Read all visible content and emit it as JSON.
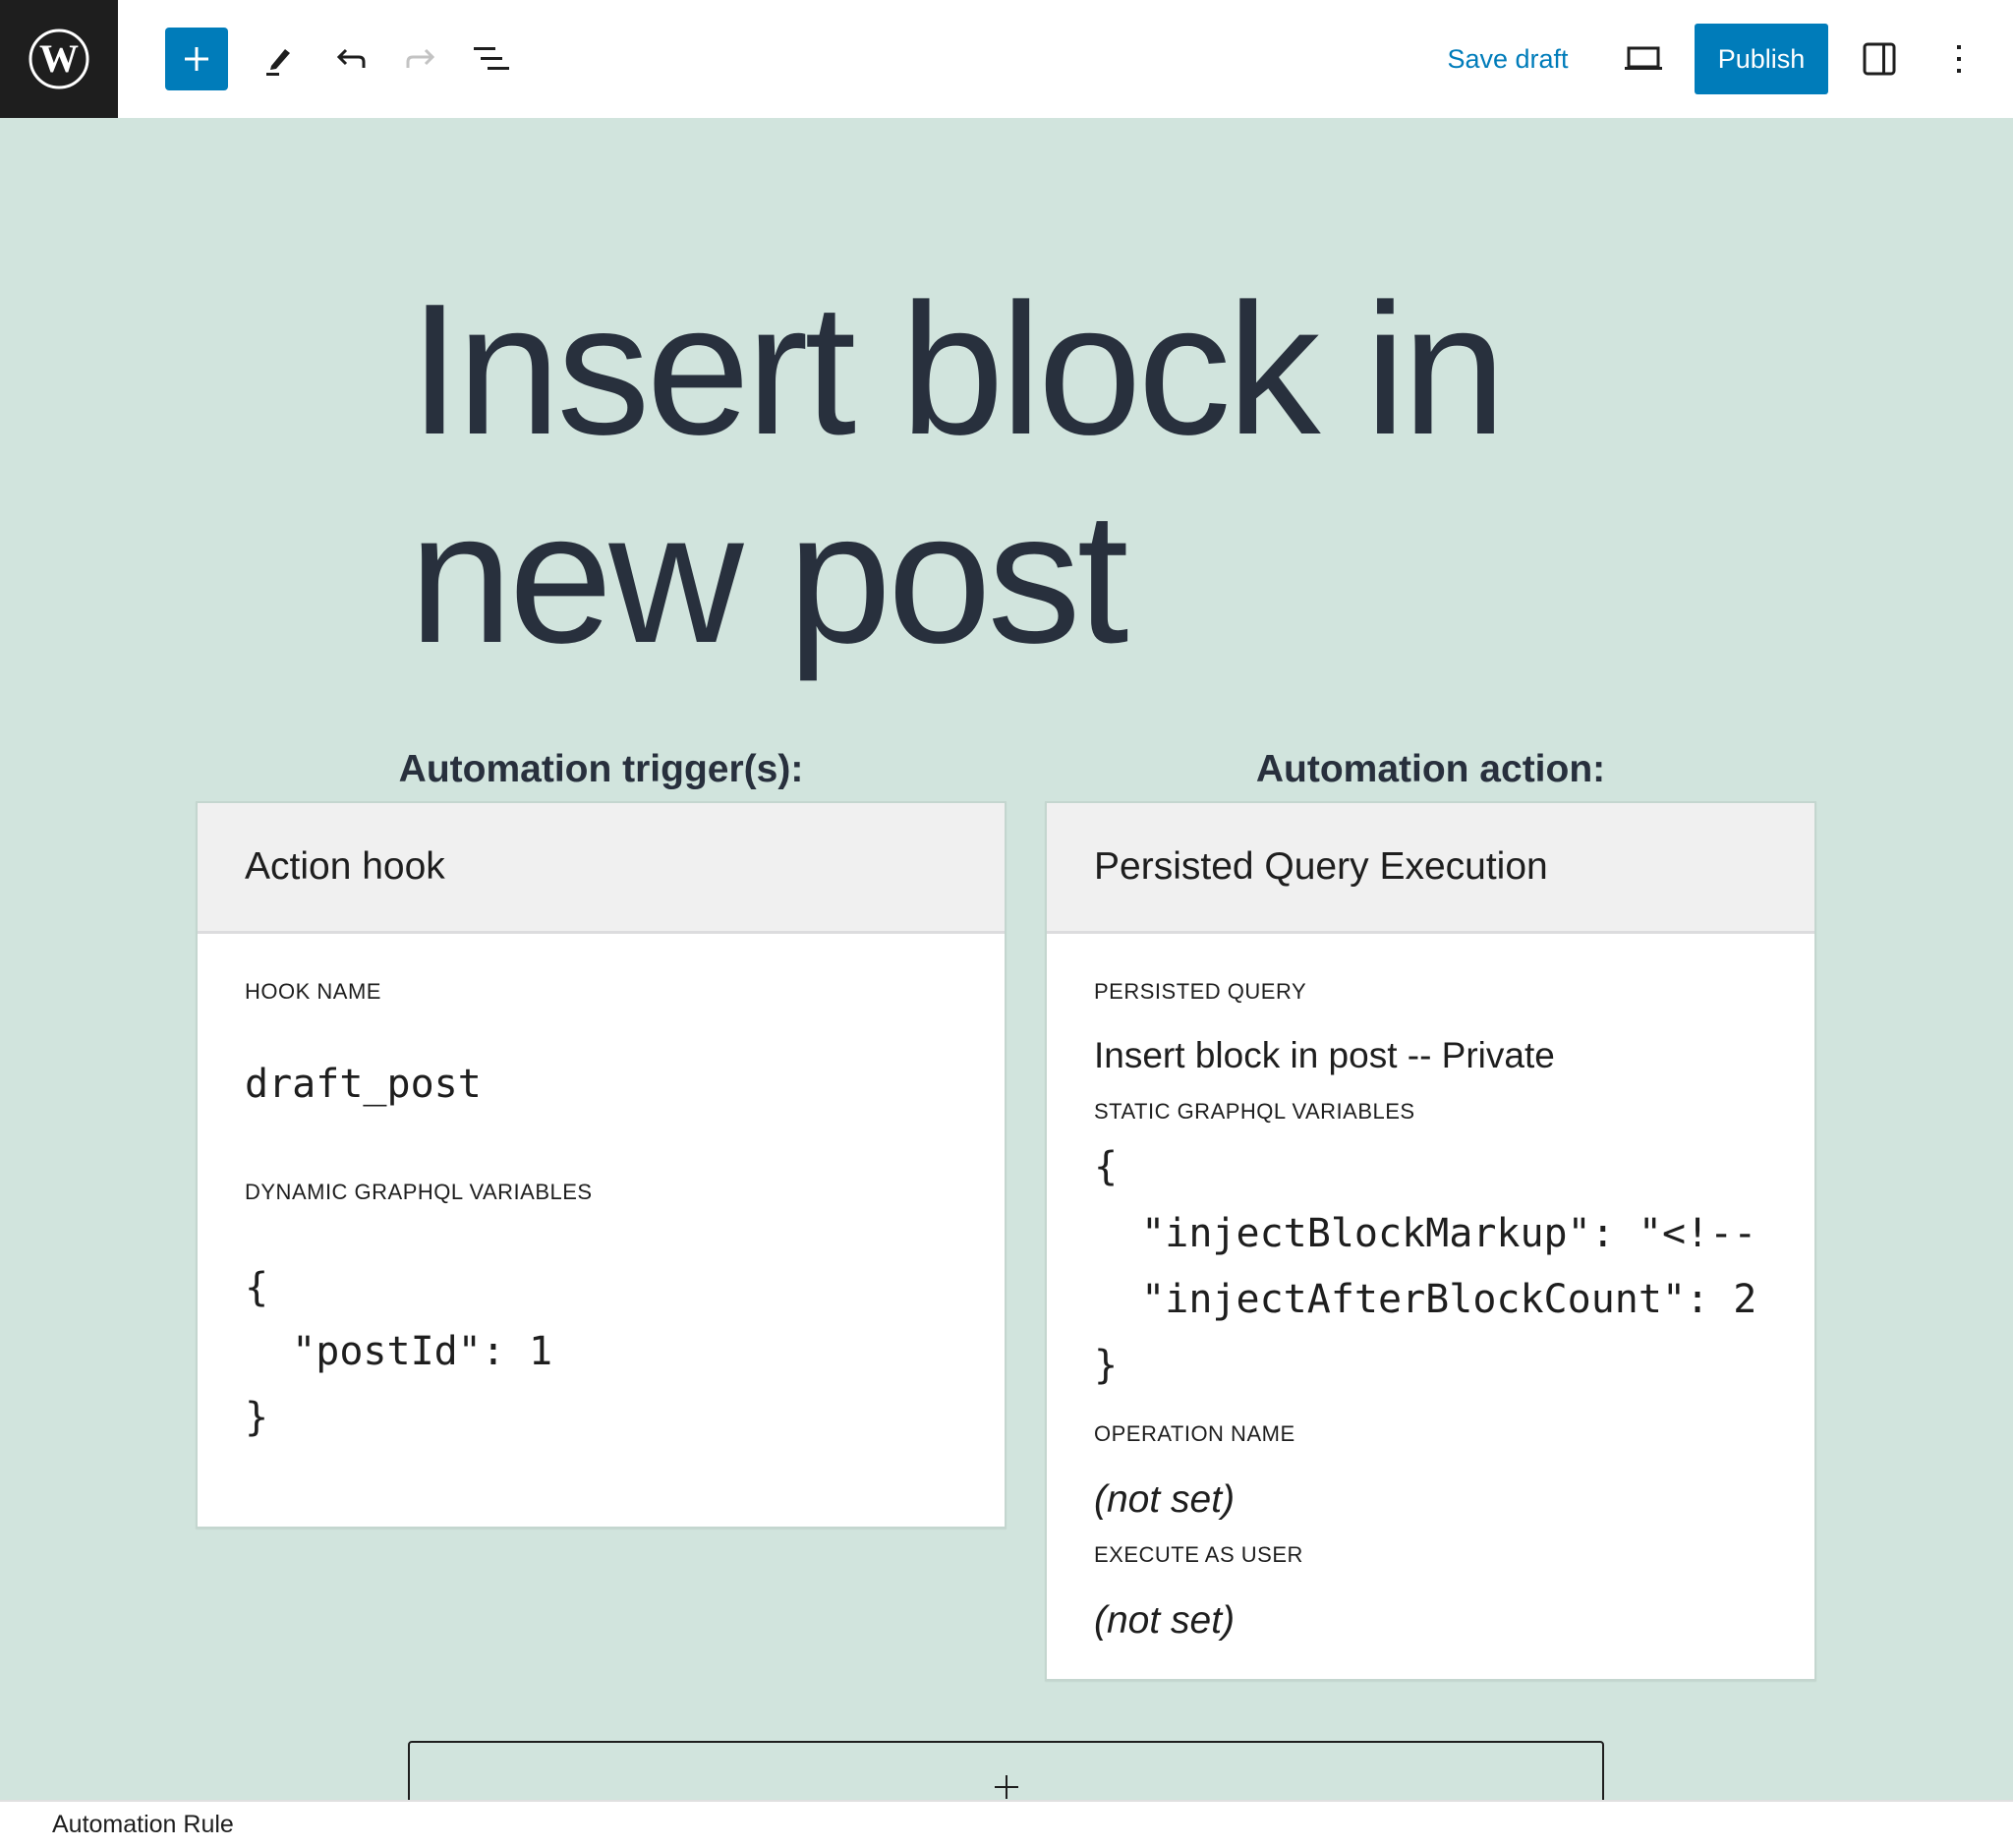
{
  "toolbar": {
    "logo_icon": "wordpress-logo",
    "add_block_icon": "plus-icon",
    "tools_icon": "pencil-icon",
    "undo_icon": "undo-icon",
    "redo_icon": "redo-icon",
    "list_view_icon": "list-view-icon",
    "save_draft_label": "Save draft",
    "preview_icon": "laptop-icon",
    "publish_label": "Publish",
    "settings_icon": "sidebar-toggle-icon",
    "options_icon": "kebab-menu-icon",
    "accent_color": "#007cba"
  },
  "post": {
    "title_line1": "Insert block in",
    "title_line2": "new post"
  },
  "trigger": {
    "heading": "Automation trigger(s):",
    "card_title": "Action hook",
    "hook_name_label": "HOOK NAME",
    "hook_name_value": "draft_post",
    "variables_label": "DYNAMIC GRAPHQL VARIABLES",
    "variables_lines": [
      "{",
      "  \"postId\": 1",
      "}"
    ]
  },
  "action": {
    "heading": "Automation action:",
    "card_title": "Persisted Query Execution",
    "persisted_query_label": "PERSISTED QUERY",
    "persisted_query_value": "Insert block in post -- Private",
    "variables_label": "STATIC GRAPHQL VARIABLES",
    "variables_lines": [
      "{",
      "  \"injectBlockMarkup\": \"<!--",
      "  \"injectAfterBlockCount\": 2",
      "}"
    ],
    "operation_name_label": "OPERATION NAME",
    "operation_name_value": "(not set)",
    "execute_as_user_label": "EXECUTE AS USER",
    "execute_as_user_value": "(not set)"
  },
  "appender": {
    "icon": "plus-icon"
  },
  "footer": {
    "breadcrumb": "Automation Rule"
  }
}
